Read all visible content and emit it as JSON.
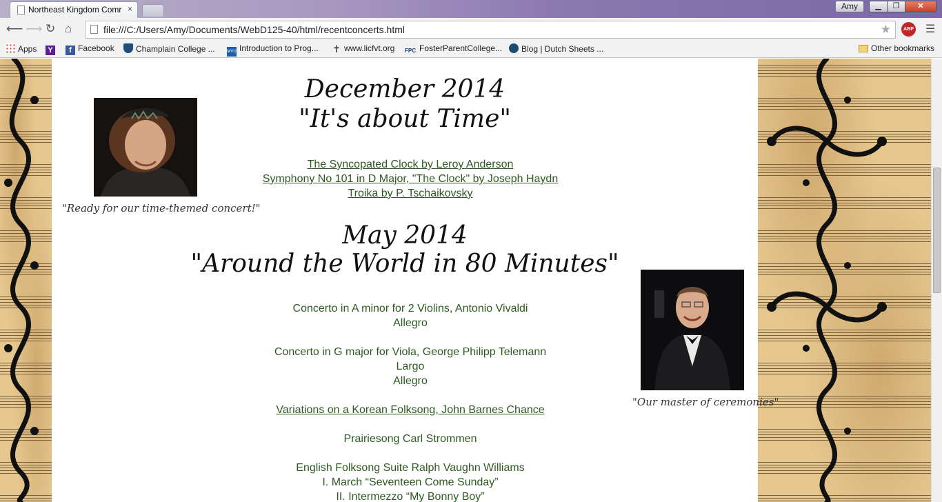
{
  "browser": {
    "tab_title": "Northeast Kingdom Comr",
    "tab_close": "×",
    "user": "Amy",
    "window_buttons": {
      "minimize": "▁",
      "maximize": "❐",
      "close": "✕"
    },
    "url": "file:///C:/Users/Amy/Documents/WebD125-40/html/recentconcerts.html",
    "icons": {
      "back": "arrow-left-icon",
      "forward": "arrow-right-icon",
      "reload": "reload-icon",
      "home": "home-icon",
      "star": "star-icon",
      "menu": "hamburger-menu-icon",
      "adblock": "adblock-plus-icon"
    },
    "glyphs": {
      "back": "⟵",
      "forward": "⟶",
      "reload": "↻",
      "home": "⌂",
      "star": "★",
      "menu": "☰",
      "abp": "ABP"
    },
    "bookmarks": [
      {
        "label": "Apps",
        "icon": "apps-grid-icon"
      },
      {
        "label": "",
        "icon": "yahoo-icon"
      },
      {
        "label": "Facebook",
        "icon": "facebook-icon"
      },
      {
        "label": "Champlain College ...",
        "icon": "champlain-icon"
      },
      {
        "label": "Introduction to Prog...",
        "icon": "mvu-icon"
      },
      {
        "label": "www.licfvt.org",
        "icon": "cross-icon"
      },
      {
        "label": "FosterParentCollege...",
        "icon": "fpc-icon"
      },
      {
        "label": "Blog | Dutch Sheets ...",
        "icon": "blog-icon"
      }
    ],
    "other_bookmarks": "Other bookmarks"
  },
  "page": {
    "dec": {
      "title": "December 2014",
      "subtitle": "\"It's about Time\"",
      "links": [
        "The Syncopated Clock by Leroy Anderson",
        "Symphony No 101 in D Major, \"The Clock\" by Joseph Haydn",
        "Troika by P. Tschaikovsky"
      ],
      "caption": "\"Ready for our time-themed concert!\""
    },
    "may": {
      "title": "May 2014",
      "subtitle": "\"Around the World in 80 Minutes\"",
      "items": {
        "vivaldi": "Concerto in A minor for 2 Violins, Antonio Vivaldi",
        "vivaldi_mv": "Allegro",
        "telemann": "Concerto in G major for Viola, George Philipp Telemann",
        "telemann_mv1": "Largo",
        "telemann_mv2": "Allegro",
        "korean": "Variations on a Korean Folksong, John Barnes Chance",
        "prairie": "Prairiesong Carl Strommen",
        "english": "English Folksong Suite Ralph Vaughn Williams",
        "english_mv1": "I. March “Seventeen Come Sunday”",
        "english_mv2": "II. Intermezzo “My Bonny Boy”"
      },
      "caption": "\"Our master of ceremonies\""
    }
  },
  "colors": {
    "link_green": "#2e5a22",
    "paper": "#e6c88f",
    "swirl": "#111111"
  }
}
